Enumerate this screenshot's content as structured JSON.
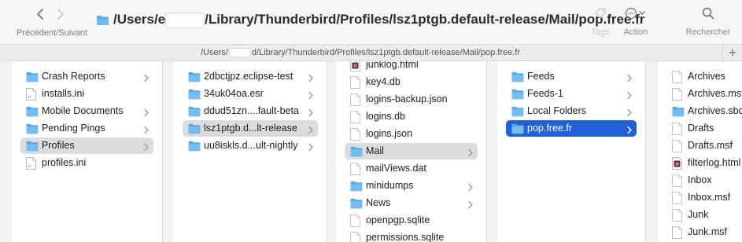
{
  "toolbar": {
    "nav_label": "Précédent/Suivant",
    "title_prefix": "/Users/e",
    "title_suffix": "/Library/Thunderbird/Profiles/lsz1ptgb.default-release/Mail/pop.free.fr",
    "tags_label": "Tags",
    "action_label": "Action",
    "search_label": "Rechercher"
  },
  "pathbar": {
    "prefix": "/Users/",
    "suffix": "d/Library/Thunderbird/Profiles/lsz1ptgb.default-release/Mail/pop.free.fr",
    "add_tab": "+"
  },
  "columns": {
    "col1": [
      {
        "name": "Crash Reports",
        "icon": "folder-icon"
      },
      {
        "name": "installs.ini",
        "icon": "ini-file-icon"
      },
      {
        "name": "Mobile Documents",
        "icon": "folder-icon"
      },
      {
        "name": "Pending Pings",
        "icon": "folder-icon"
      },
      {
        "name": "Profiles",
        "icon": "folder-icon"
      },
      {
        "name": "profiles.ini",
        "icon": "ini-file-icon"
      }
    ],
    "col2": [
      {
        "name": "2dbctjpz.eclipse-test",
        "icon": "folder-icon"
      },
      {
        "name": "34uk04oa.esr",
        "icon": "folder-icon"
      },
      {
        "name": "ddud51zn....fault-beta",
        "icon": "folder-icon"
      },
      {
        "name": "lsz1ptgb.d...lt-release",
        "icon": "folder-icon"
      },
      {
        "name": "uu8iskls.d...ult-nightly",
        "icon": "folder-icon"
      }
    ],
    "col3": [
      {
        "name": "junklog.html",
        "icon": "html-file-icon"
      },
      {
        "name": "key4.db",
        "icon": "file-icon"
      },
      {
        "name": "logins-backup.json",
        "icon": "file-icon"
      },
      {
        "name": "logins.db",
        "icon": "file-icon"
      },
      {
        "name": "logins.json",
        "icon": "file-icon"
      },
      {
        "name": "Mail",
        "icon": "folder-icon"
      },
      {
        "name": "mailViews.dat",
        "icon": "file-icon"
      },
      {
        "name": "minidumps",
        "icon": "folder-icon"
      },
      {
        "name": "News",
        "icon": "folder-icon"
      },
      {
        "name": "openpgp.sqlite",
        "icon": "file-icon"
      },
      {
        "name": "permissions.sqlite",
        "icon": "file-icon"
      }
    ],
    "col4": [
      {
        "name": "Feeds",
        "icon": "folder-icon"
      },
      {
        "name": "Feeds-1",
        "icon": "folder-icon"
      },
      {
        "name": "Local Folders",
        "icon": "folder-icon"
      },
      {
        "name": "pop.free.fr",
        "icon": "folder-icon"
      }
    ],
    "col5": [
      {
        "name": "Archives",
        "icon": "file-icon"
      },
      {
        "name": "Archives.msf",
        "icon": "file-icon"
      },
      {
        "name": "Archives.sbd",
        "icon": "folder-icon"
      },
      {
        "name": "Drafts",
        "icon": "file-icon"
      },
      {
        "name": "Drafts.msf",
        "icon": "file-icon"
      },
      {
        "name": "filterlog.html",
        "icon": "html-file-icon"
      },
      {
        "name": "Inbox",
        "icon": "file-icon"
      },
      {
        "name": "Inbox.msf",
        "icon": "file-icon"
      },
      {
        "name": "Junk",
        "icon": "file-icon"
      },
      {
        "name": "Junk.msf",
        "icon": "file-icon"
      }
    ]
  },
  "colors": {
    "folder": "#5aa9e6",
    "selection_blue": "#2260d6",
    "selection_grey": "#dcdcdc"
  }
}
